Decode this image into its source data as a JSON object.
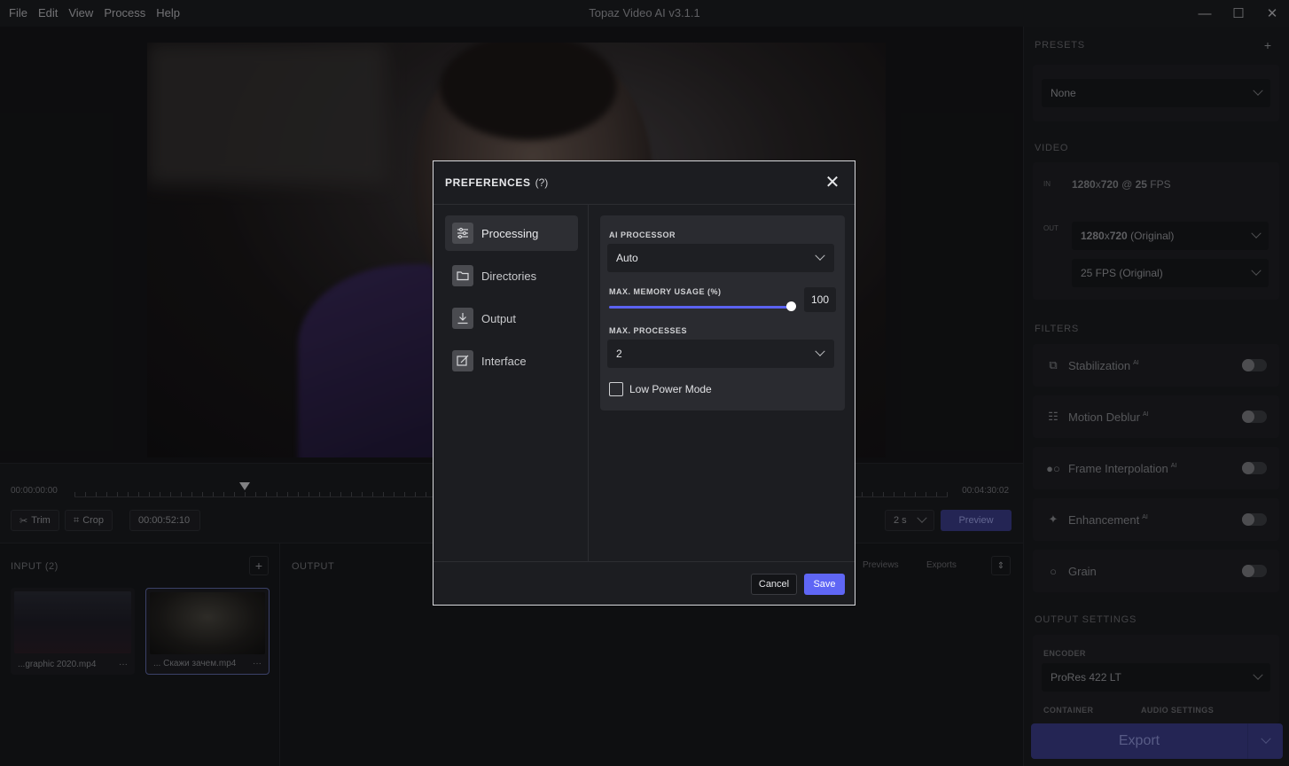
{
  "titlebar": {
    "menu": [
      "File",
      "Edit",
      "View",
      "Process",
      "Help"
    ],
    "title": "Topaz Video AI  v3.1.1",
    "min": "—",
    "max": "☐",
    "close": "✕"
  },
  "timeline": {
    "start_tc": "00:00:00:00",
    "end_tc": "00:04:30:02",
    "trim_label": "Trim",
    "crop_label": "Crop",
    "current_tc": "00:00:52:10",
    "duration_value": "2 s",
    "preview_label": "Preview"
  },
  "input": {
    "label": "INPUT (2)",
    "files": [
      {
        "name": "...graphic 2020.mp4",
        "more": "···"
      },
      {
        "name": "... Скажи зачем.mp4",
        "more": "···"
      }
    ]
  },
  "output": {
    "label": "OUTPUT",
    "previews_tab": "Previews",
    "exports_tab": "Exports"
  },
  "right": {
    "presets_label": "PRESETS",
    "preset_value": "None",
    "video_label": "VIDEO",
    "in_tag": "IN",
    "in_res": "1280",
    "in_x": "x",
    "in_res2": "720",
    "in_at": " @ ",
    "in_fps": "25",
    "in_fps_unit": " FPS",
    "out_tag": "OUT",
    "out_res": "1280",
    "out_x": "x",
    "out_res2": "720",
    "out_res_note": " (Original)",
    "out_fps": "25 FPS (Original)",
    "filters_label": "FILTERS",
    "filters": [
      {
        "name": "Stabilization",
        "ai": "AI"
      },
      {
        "name": "Motion Deblur",
        "ai": "AI"
      },
      {
        "name": "Frame Interpolation",
        "ai": "AI"
      },
      {
        "name": "Enhancement",
        "ai": "AI"
      },
      {
        "name": "Grain",
        "ai": ""
      }
    ],
    "output_settings_label": "OUTPUT SETTINGS",
    "encoder_label": "ENCODER",
    "encoder_value": "ProRes 422 LT",
    "container_label": "CONTAINER",
    "audio_label": "AUDIO SETTINGS",
    "export_label": "Export"
  },
  "dialog": {
    "title": "PREFERENCES",
    "help": "(?)",
    "nav": [
      {
        "label": "Processing",
        "active": true
      },
      {
        "label": "Directories",
        "active": false
      },
      {
        "label": "Output",
        "active": false
      },
      {
        "label": "Interface",
        "active": false
      }
    ],
    "ai_processor_label": "AI PROCESSOR",
    "ai_processor_value": "Auto",
    "memory_label": "MAX. MEMORY USAGE (%)",
    "memory_value": "100",
    "processes_label": "MAX. PROCESSES",
    "processes_value": "2",
    "low_power_label": "Low Power Mode",
    "low_power_checked": false,
    "cancel_label": "Cancel",
    "save_label": "Save"
  },
  "colors": {
    "accent": "#5f66f5",
    "export_btn": "#3a3d88"
  }
}
